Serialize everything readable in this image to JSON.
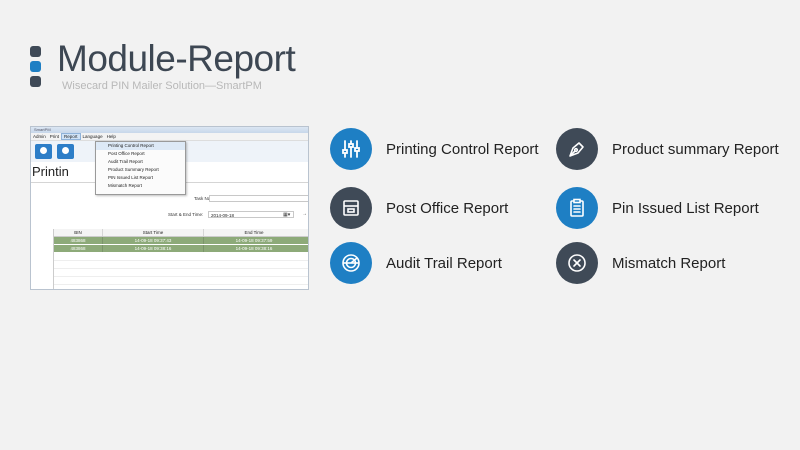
{
  "header": {
    "title": "Module-Report",
    "subtitle": "Wisecard PIN Mailer Solution—SmartPM"
  },
  "screenshot": {
    "window_title": "SmartPM",
    "menu": [
      "Admin",
      "Print",
      "Report",
      "Language",
      "Help"
    ],
    "active_menu": "Report",
    "report_menu_items": [
      "Printing Control Report",
      "Post Office Report",
      "Audit Trail Report",
      "Product Summary Report",
      "PIN Issued List Report",
      "Mismatch Report"
    ],
    "page_title": "Printin",
    "task_name_label": "Task Name:",
    "task_name_value": "",
    "date_label": "Start & End Time:",
    "date_value": "2014-09-18",
    "table": {
      "headers": [
        "BIN",
        "Start Time",
        "End Time"
      ],
      "rows": [
        [
          "483868",
          "14-09-18 09:37:43",
          "14-09-18 09:37:59"
        ],
        [
          "483868",
          "14-09-18 09:38:16",
          "14-09-18 09:38:16"
        ]
      ]
    }
  },
  "reports": [
    {
      "label": "Printing Control Report",
      "icon": "sliders-icon",
      "color": "#1e7fc4"
    },
    {
      "label": "Product summary Report",
      "icon": "pen-nib-icon",
      "color": "#3f4a57"
    },
    {
      "label": "Post Office Report",
      "icon": "mailbox-icon",
      "color": "#3f4a57"
    },
    {
      "label": "Pin Issued List Report",
      "icon": "clipboard-list-icon",
      "color": "#1e7fc4"
    },
    {
      "label": "Audit Trail Report",
      "icon": "radar-icon",
      "color": "#1e7fc4"
    },
    {
      "label": "Mismatch Report",
      "icon": "x-circle-icon",
      "color": "#3f4a57"
    }
  ]
}
